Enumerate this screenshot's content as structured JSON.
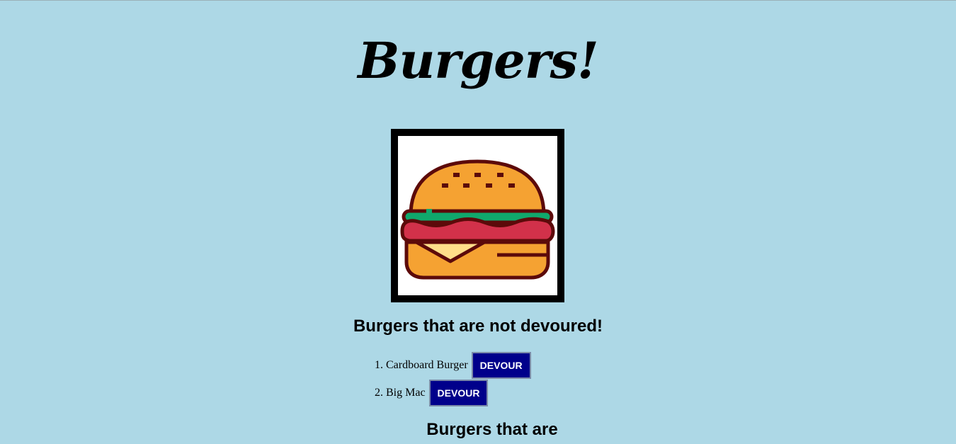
{
  "page": {
    "title": "Burgers!"
  },
  "logo": {
    "icon": "burger-icon"
  },
  "sections": {
    "not_devoured_heading": "Burgers that are not devoured!",
    "devoured_heading": "Burgers that are"
  },
  "not_devoured": [
    {
      "number": "1.",
      "name": "Cardboard Burger",
      "button_label": "DEVOUR"
    },
    {
      "number": "2.",
      "name": "Big Mac",
      "button_label": "DEVOUR"
    }
  ],
  "colors": {
    "background": "#add8e6",
    "button": "#00008b",
    "bun": "#f5a232",
    "lettuce": "#10a86c",
    "patty": "#d2314a",
    "cheese": "#ffdf8a",
    "outline": "#5c0a0a"
  }
}
